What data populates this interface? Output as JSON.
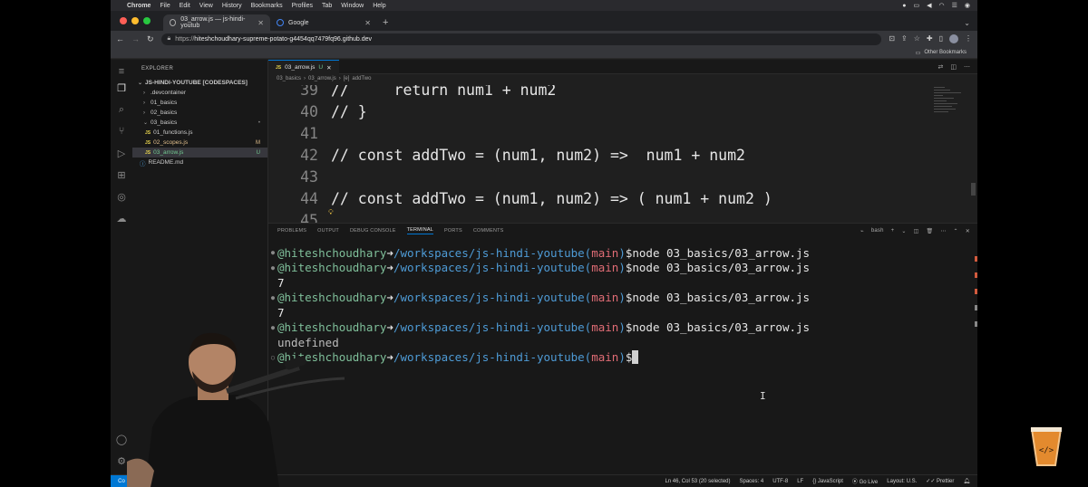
{
  "menubar": {
    "app": "Chrome",
    "items": [
      "File",
      "Edit",
      "View",
      "History",
      "Bookmarks",
      "Profiles",
      "Tab",
      "Window",
      "Help"
    ]
  },
  "browser": {
    "tabs": [
      {
        "title": "03_arrow.js — js-hindi-youtub",
        "active": true
      },
      {
        "title": "Google",
        "active": false
      }
    ],
    "url_scheme": "https://",
    "url_host": "hiteshchoudhary-supreme-potato-g4454qq7479fq96.github.dev",
    "bookmarks_label": "Other Bookmarks"
  },
  "explorer": {
    "title": "EXPLORER",
    "root": "JS-HINDI-YOUTUBE [CODESPACES]",
    "items": [
      {
        "label": ".devcontainer",
        "type": "folder",
        "open": false,
        "depth": 1,
        "badge": ""
      },
      {
        "label": "01_basics",
        "type": "folder",
        "open": false,
        "depth": 1,
        "badge": ""
      },
      {
        "label": "02_basics",
        "type": "folder",
        "open": false,
        "depth": 1,
        "badge": ""
      },
      {
        "label": "03_basics",
        "type": "folder",
        "open": true,
        "depth": 1,
        "badge": "•"
      },
      {
        "label": "01_functions.js",
        "type": "js",
        "depth": 2,
        "badge": ""
      },
      {
        "label": "02_scopes.js",
        "type": "js",
        "depth": 2,
        "badge": "M"
      },
      {
        "label": "03_arrow.js",
        "type": "js",
        "depth": 2,
        "badge": "U",
        "selected": true
      },
      {
        "label": "README.md",
        "type": "md",
        "depth": 1,
        "badge": ""
      }
    ]
  },
  "editor": {
    "tab_label": "03_arrow.js",
    "tab_status": "U",
    "breadcrumb": [
      "03_basics",
      "03_arrow.js",
      "addTwo"
    ],
    "lines": [
      {
        "num": "39",
        "text": "//     return num1 + num2"
      },
      {
        "num": "40",
        "text": "// }"
      },
      {
        "num": "41",
        "text": ""
      },
      {
        "num": "42",
        "text": "// const addTwo = (num1, num2) =>  num1 + num2"
      },
      {
        "num": "43",
        "text": ""
      },
      {
        "num": "44",
        "text": "// const addTwo = (num1, num2) => ( num1 + num2 )"
      },
      {
        "num": "45",
        "text": ""
      }
    ]
  },
  "panel": {
    "tabs": [
      "PROBLEMS",
      "OUTPUT",
      "DEBUG CONSOLE",
      "TERMINAL",
      "PORTS",
      "COMMENTS"
    ],
    "active_tab": "TERMINAL",
    "shell": "bash"
  },
  "terminal": {
    "prompt_user": "@hiteshchoudhary",
    "prompt_arrow": "➜",
    "prompt_path": "/workspaces/js-hindi-youtube",
    "prompt_branch_open": "(",
    "prompt_branch": "main",
    "prompt_branch_close": ")",
    "prompt_symbol": "$",
    "command": "node 03_basics/03_arrow.js",
    "outputs": [
      "7",
      "7",
      "undefined"
    ]
  },
  "statusbar": {
    "remote": "Co",
    "position": "Ln 46, Col 53 (20 selected)",
    "spaces": "Spaces: 4",
    "encoding": "UTF-8",
    "eol": "LF",
    "language": "JavaScript",
    "golive": "Go Live",
    "layout": "Layout: U.S.",
    "prettier": "Prettier"
  },
  "colors": {
    "accent": "#0078d4",
    "path": "#4e9bd6",
    "branch": "#e06c75",
    "user": "#7fbf9a"
  }
}
